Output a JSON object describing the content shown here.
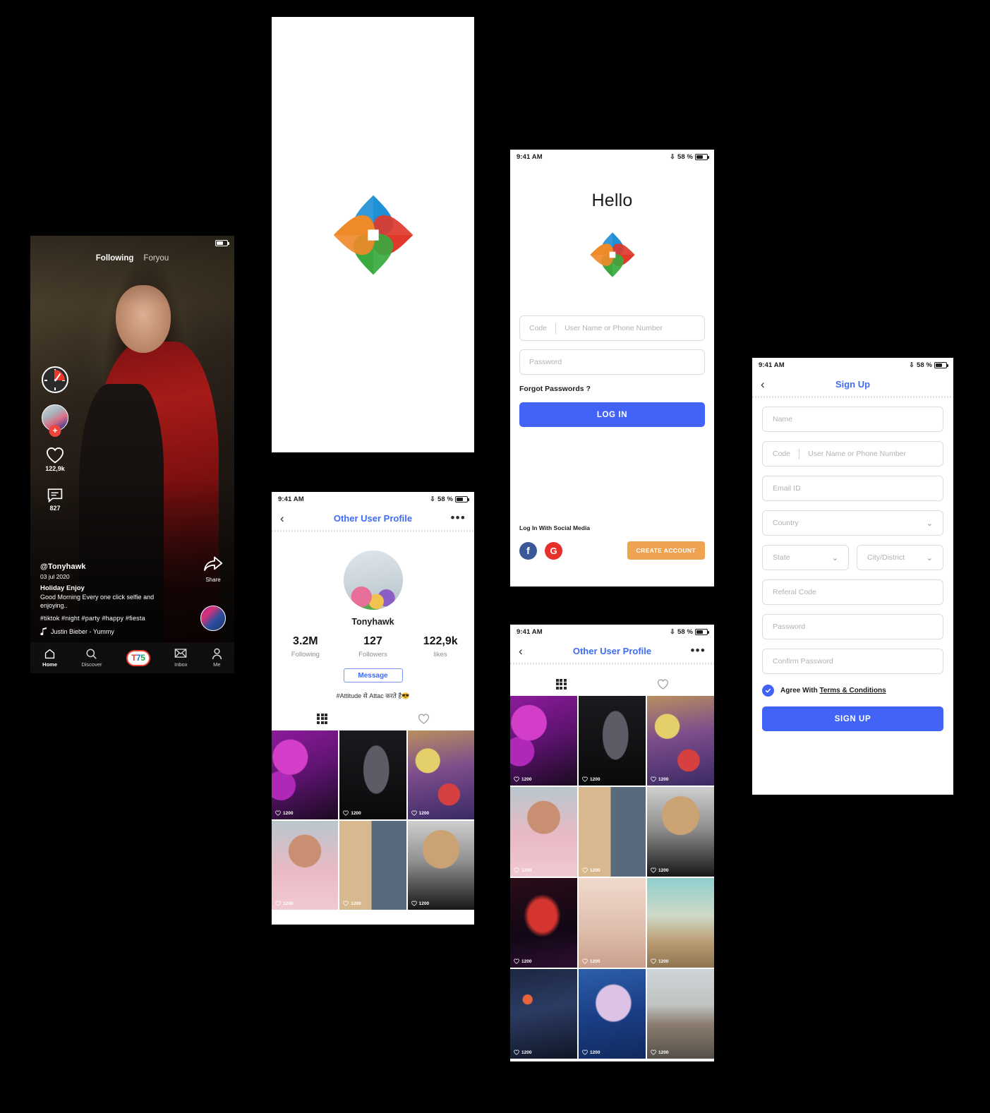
{
  "common": {
    "status_time": "9:41 AM",
    "battery_pct": "58 %",
    "bluetooth_icon": "bluetooth-icon"
  },
  "colors": {
    "accent_blue": "#4263f5",
    "link_blue": "#3f6bf5",
    "orange": "#efa351",
    "red": "#e8392f",
    "logo_blue": "#1f8fd6",
    "logo_red": "#e0392c",
    "logo_green": "#3aa93f",
    "logo_orange": "#ef8a2b"
  },
  "feed": {
    "tabs": [
      {
        "label": "Following",
        "active": true
      },
      {
        "label": "Foryou",
        "active": false
      }
    ],
    "rail": {
      "music_disc": "music-disc-icon",
      "follow_plus": "+",
      "likes": "122,9k",
      "comments": "827"
    },
    "caption": {
      "username": "@Tonyhawk",
      "date": "03 jul 2020",
      "title": "Holiday Enjoy",
      "desc": "Good Morning Every one click selfie and enjoying..",
      "hashtags": "#tiktok  #night  #party  #happy  #fiesta",
      "music": "Justin Bieber - Yummy"
    },
    "share_label": "Share",
    "nav": [
      {
        "label": "Home",
        "icon": "home-icon",
        "active": true
      },
      {
        "label": "Discover",
        "icon": "search-icon",
        "active": false
      },
      {
        "label": "T75",
        "icon": "t75-logo",
        "active": false
      },
      {
        "label": "Inbox",
        "icon": "envelope-icon",
        "active": false
      },
      {
        "label": "Me",
        "icon": "person-icon",
        "active": false
      }
    ],
    "brand": {
      "t": "T",
      "seven": "7",
      "five": "5"
    }
  },
  "splash": {
    "logo": "app-pinwheel-logo"
  },
  "profile": {
    "nav": {
      "back": "‹",
      "title": "Other User Profile",
      "more": "•••"
    },
    "name": "Tonyhawk",
    "stats": [
      {
        "value": "3.2M",
        "key": "Following"
      },
      {
        "value": "127",
        "key": "Followers"
      },
      {
        "value": "122,9k",
        "key": "likes"
      }
    ],
    "message_button": "Message",
    "bio": "#Attitude से  Attac करते है😎",
    "tabs": [
      {
        "icon": "grid-icon",
        "active": true
      },
      {
        "icon": "heart-icon",
        "active": false
      }
    ],
    "grid": [
      {
        "likes": "1200",
        "alt": "runway-model-purple"
      },
      {
        "likes": "1200",
        "alt": "black-gown-runway"
      },
      {
        "likes": "1200",
        "alt": "red-boots-runway"
      },
      {
        "likes": "1200",
        "alt": "pink-hoodie-selfie"
      },
      {
        "likes": "1200",
        "alt": "baby-and-man-split"
      },
      {
        "likes": "1200",
        "alt": "curly-hair-portrait"
      }
    ]
  },
  "login": {
    "heading": "Hello",
    "code_placeholder": "Code",
    "user_placeholder": "User Name or Phone Number",
    "password_placeholder": "Password",
    "forgot": "Forgot Passwords ?",
    "login_button": "LOG IN",
    "social_label": "Log In With Social Media",
    "facebook_icon": "facebook-icon",
    "google_icon": "google-icon",
    "facebook_glyph": "f",
    "google_glyph": "G",
    "create_button": "CREATE ACCOUNT"
  },
  "grid_screen": {
    "nav": {
      "back": "‹",
      "title": "Other User Profile",
      "more": "•••"
    },
    "tabs": [
      {
        "icon": "grid-icon",
        "active": true
      },
      {
        "icon": "heart-icon",
        "active": false
      }
    ],
    "grid": [
      {
        "likes": "1200",
        "alt": "runway-model-purple"
      },
      {
        "likes": "1200",
        "alt": "black-gown-runway"
      },
      {
        "likes": "1200",
        "alt": "red-boots-runway"
      },
      {
        "likes": "1200",
        "alt": "pink-hoodie-selfie"
      },
      {
        "likes": "1200",
        "alt": "baby-and-man-split"
      },
      {
        "likes": "1200",
        "alt": "curly-hair-portrait"
      },
      {
        "likes": "1200",
        "alt": "breakdance-red-stage"
      },
      {
        "likes": "1200",
        "alt": "breakdance-corridor"
      },
      {
        "likes": "1200",
        "alt": "blonde-sunglasses-coat"
      },
      {
        "likes": "1200",
        "alt": "woman-city-night"
      },
      {
        "likes": "1200",
        "alt": "blue-hoodie-mask"
      },
      {
        "likes": "1200",
        "alt": "lighthouse-motorcycle"
      }
    ]
  },
  "signup": {
    "nav": {
      "back": "‹",
      "title": "Sign Up"
    },
    "fields": [
      {
        "placeholder": "Name",
        "type": "text"
      },
      {
        "placeholder": "Email ID",
        "type": "text"
      },
      {
        "placeholder": "Country",
        "type": "select"
      },
      {
        "placeholder": "State",
        "type": "select"
      },
      {
        "placeholder": "City/District",
        "type": "select"
      },
      {
        "placeholder": "Referal Code",
        "type": "text"
      },
      {
        "placeholder": "Password",
        "type": "text"
      },
      {
        "placeholder": "Confirm Password",
        "type": "text"
      }
    ],
    "code_placeholder": "Code",
    "user_placeholder": "User Name or Phone Number",
    "agree_prefix": "Agree With ",
    "agree_link": "Terms & Conditions",
    "signup_button": "SIGN UP",
    "chevron": "chevron-down-icon"
  }
}
